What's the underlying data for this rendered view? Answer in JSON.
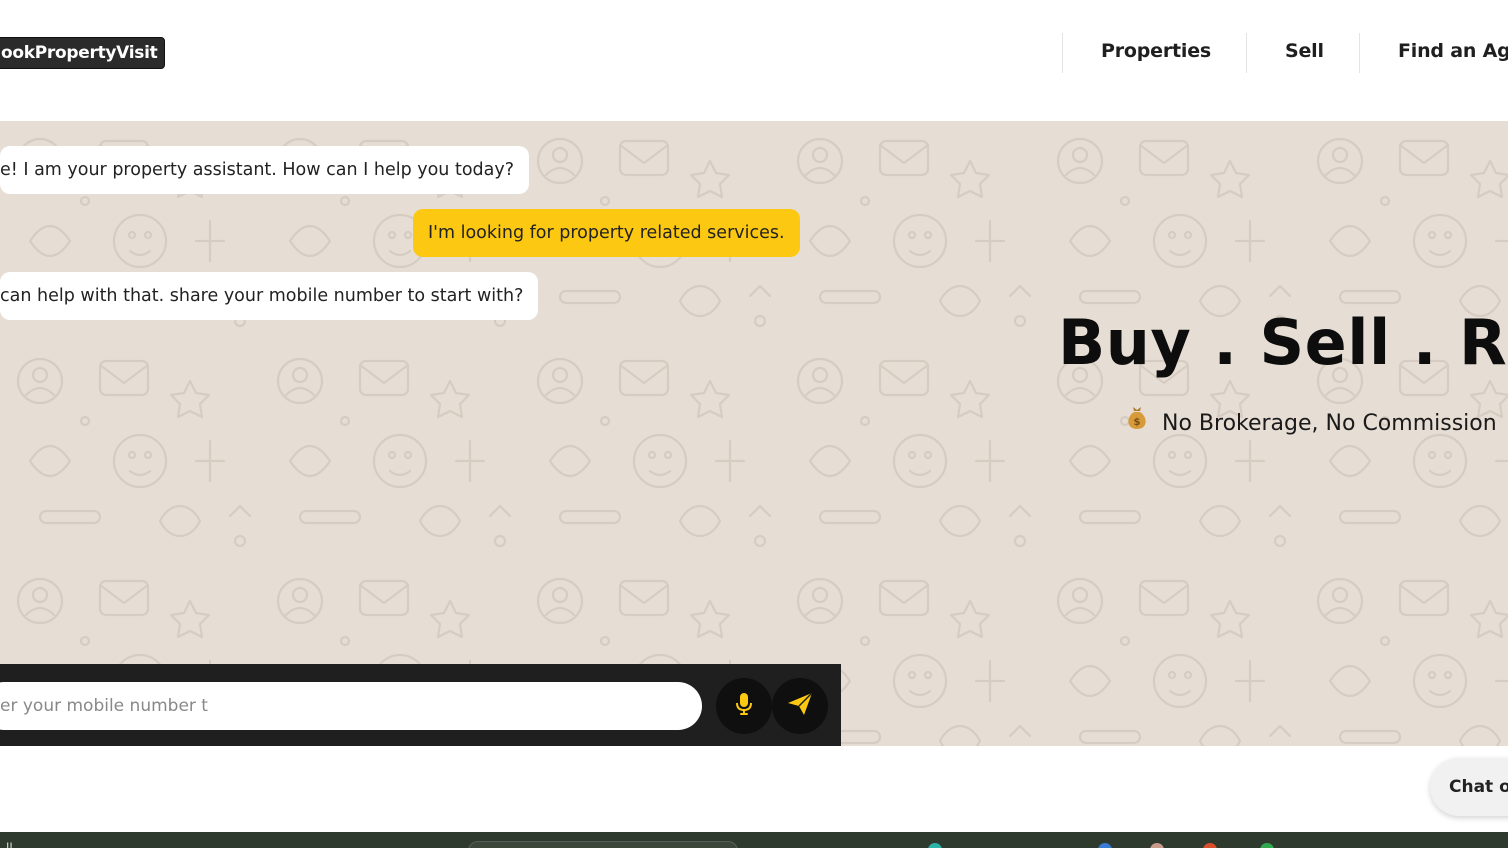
{
  "header": {
    "logo_text": "ookPropertyVisit",
    "nav": [
      {
        "label": "Properties"
      },
      {
        "label": "Sell"
      },
      {
        "label": "Find an Ag"
      }
    ]
  },
  "chat": {
    "messages": [
      {
        "from": "bot",
        "text": "e! I am your property assistant. How can I help you today?"
      },
      {
        "from": "user",
        "text": "I'm looking for property related services."
      },
      {
        "from": "bot",
        "text": "can help with that. share your mobile number to start with?"
      }
    ],
    "input_placeholder": "er your mobile number t",
    "mic_icon": "microphone-icon",
    "send_icon": "paper-plane-icon"
  },
  "hero": {
    "title": "Buy . Sell . Re",
    "subtitle_icon": "money-bag-emoji",
    "subtitle": "No Brokerage, No Commission"
  },
  "chat_widget": {
    "label": "Chat o"
  },
  "taskbar": {
    "text": "ll"
  },
  "colors": {
    "accent": "#fcc812",
    "composer_bg": "#1f1f1f",
    "hero_bg": "#e6ddd4"
  }
}
